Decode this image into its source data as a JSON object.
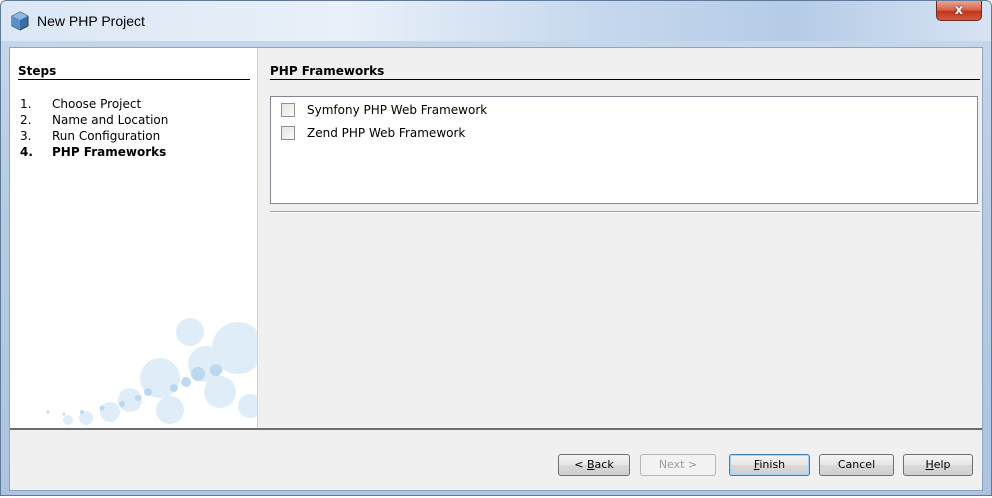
{
  "window": {
    "title": "New PHP Project",
    "close_glyph": "x",
    "icon": "netbeans-project-icon"
  },
  "steps": {
    "heading": "Steps",
    "items": [
      {
        "num": "1.",
        "label": "Choose Project"
      },
      {
        "num": "2.",
        "label": "Name and Location"
      },
      {
        "num": "3.",
        "label": "Run Configuration"
      },
      {
        "num": "4.",
        "label": "PHP Frameworks"
      }
    ],
    "current_index": 3
  },
  "main": {
    "heading": "PHP Frameworks",
    "frameworks": [
      {
        "label": "Symfony PHP Web Framework",
        "checked": false
      },
      {
        "label": "Zend PHP Web Framework",
        "checked": false
      }
    ]
  },
  "buttons": {
    "back": {
      "pre": "< ",
      "mnemonic": "B",
      "post": "ack"
    },
    "next": {
      "label": "Next >",
      "enabled": false
    },
    "finish": {
      "pre": "",
      "mnemonic": "F",
      "post": "inish"
    },
    "cancel": {
      "label": "Cancel"
    },
    "help": {
      "pre": "",
      "mnemonic": "H",
      "post": "elp"
    }
  },
  "colors": {
    "accent": "#3c7fb1",
    "close_button": "#c2361d"
  }
}
